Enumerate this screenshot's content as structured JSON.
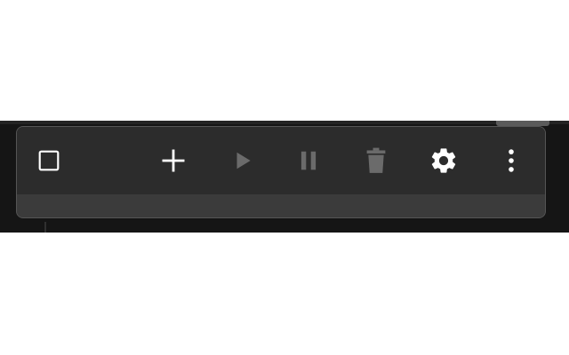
{
  "toolbar": {
    "items": [
      {
        "id": "select",
        "icon": "checkbox-outline-icon",
        "enabled": true
      },
      {
        "id": "add",
        "icon": "plus-icon",
        "enabled": true
      },
      {
        "id": "play",
        "icon": "play-icon",
        "enabled": false
      },
      {
        "id": "pause",
        "icon": "pause-icon",
        "enabled": false
      },
      {
        "id": "delete",
        "icon": "trash-icon",
        "enabled": false
      },
      {
        "id": "settings",
        "icon": "gear-icon",
        "enabled": true
      },
      {
        "id": "more",
        "icon": "more-vertical-icon",
        "enabled": true
      }
    ]
  },
  "colors": {
    "background": "#151515",
    "toolbar": "#2c2c2c",
    "toolbar_footer": "#3b3b3b",
    "icon_enabled": "#ffffff",
    "icon_disabled": "#6b6b6b"
  }
}
